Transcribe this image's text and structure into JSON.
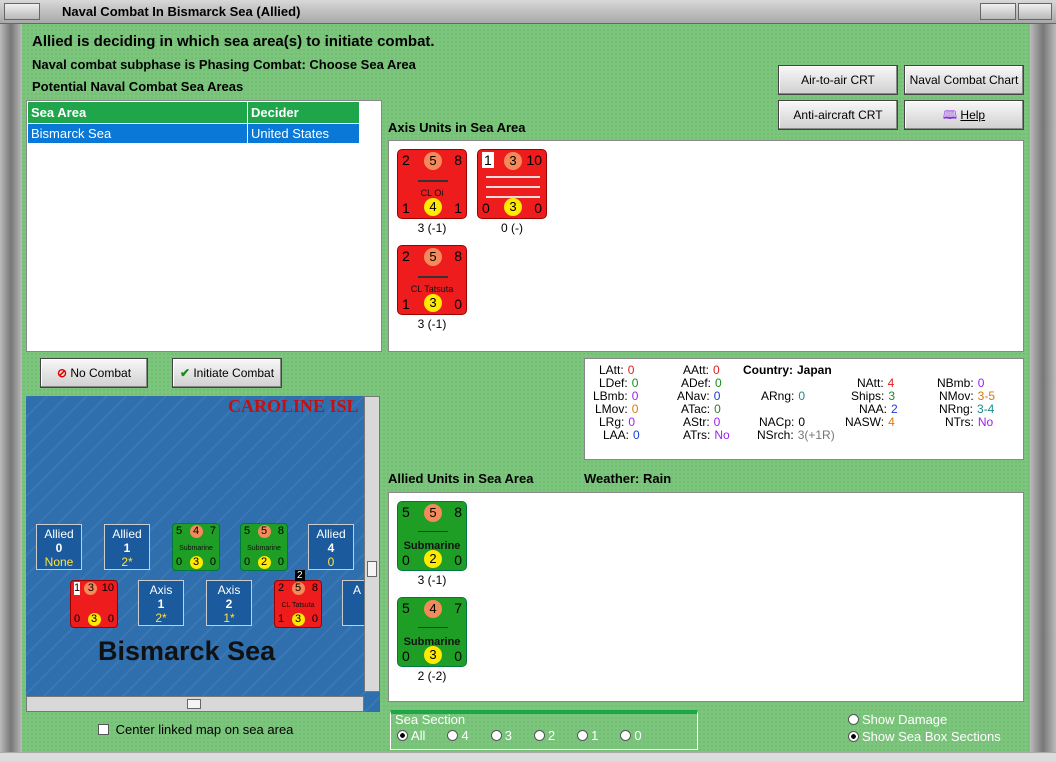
{
  "window": {
    "title": "Naval Combat In Bismarck Sea (Allied)"
  },
  "header": {
    "line1": "Allied is deciding in which sea area(s) to initiate combat.",
    "line2": "Naval combat subphase is Phasing Combat: Choose Sea Area",
    "line3": "Potential Naval Combat Sea Areas"
  },
  "buttons": {
    "air_to_air": "Air-to-air CRT",
    "naval_chart": "Naval Combat Chart",
    "anti_aircraft": "Anti-aircraft CRT",
    "help": "Help",
    "no_combat": "No Combat",
    "initiate_combat": "Initiate Combat"
  },
  "sea_table": {
    "headers": [
      "Sea Area",
      "Decider"
    ],
    "rows": [
      [
        "Bismarck Sea",
        "United States"
      ]
    ]
  },
  "axis_section": {
    "title": "Axis Units in Sea Area"
  },
  "axis_units": [
    {
      "tl": "2",
      "top": "5",
      "tr": "8",
      "name": "CL Oi",
      "bl": "1",
      "bot": "4",
      "br": "1",
      "caption": "3 (-1)"
    },
    {
      "tl": "1",
      "top": "3",
      "tr": "10",
      "name": "",
      "bl": "0",
      "bot": "3",
      "br": "0",
      "caption": "0 (-)"
    },
    {
      "tl": "2",
      "top": "5",
      "tr": "8",
      "name": "CL Tatsuta",
      "bl": "1",
      "bot": "3",
      "br": "0",
      "caption": "3 (-1)"
    }
  ],
  "allied_section": {
    "title": "Allied Units in Sea Area",
    "weather_label": "Weather:",
    "weather": "Rain"
  },
  "allied_units": [
    {
      "tl": "5",
      "top": "5",
      "tr": "8",
      "name": "Submarine",
      "bl": "0",
      "bot": "2",
      "br": "0",
      "caption": "3 (-1)"
    },
    {
      "tl": "5",
      "top": "4",
      "tr": "7",
      "name": "Submarine",
      "bl": "0",
      "bot": "3",
      "br": "0",
      "caption": "2 (-2)"
    }
  ],
  "stats": {
    "country_label": "Country:",
    "country": "Japan",
    "latt": {
      "label": "LAtt:",
      "value": "0"
    },
    "ldef": {
      "label": "LDef:",
      "value": "0"
    },
    "lbmb": {
      "label": "LBmb:",
      "value": "0"
    },
    "lmov": {
      "label": "LMov:",
      "value": "0"
    },
    "lrg": {
      "label": "LRg:",
      "value": "0"
    },
    "laa": {
      "label": "LAA:",
      "value": "0"
    },
    "aatt": {
      "label": "AAtt:",
      "value": "0"
    },
    "adef": {
      "label": "ADef:",
      "value": "0"
    },
    "anav": {
      "label": "ANav:",
      "value": "0"
    },
    "atac": {
      "label": "ATac:",
      "value": "0"
    },
    "astr": {
      "label": "AStr:",
      "value": "0"
    },
    "atrs": {
      "label": "ATrs:",
      "value": "No"
    },
    "arng": {
      "label": "ARng:",
      "value": "0"
    },
    "nacp": {
      "label": "NACp:",
      "value": "0"
    },
    "nsrch": {
      "label": "NSrch:",
      "value": "3(+1R)"
    },
    "natt": {
      "label": "NAtt:",
      "value": "4"
    },
    "ships": {
      "label": "Ships:",
      "value": "3"
    },
    "naa": {
      "label": "NAA:",
      "value": "2"
    },
    "nasw": {
      "label": "NASW:",
      "value": "4"
    },
    "nbmb": {
      "label": "NBmb:",
      "value": "0"
    },
    "nmov": {
      "label": "NMov:",
      "value": "3-5"
    },
    "nrng": {
      "label": "NRng:",
      "value": "3-4"
    },
    "ntrs": {
      "label": "NTrs:",
      "value": "No"
    },
    "colors": {
      "red": "#e21b1b",
      "purple": "#a020f0",
      "blue": "#1a3bd6",
      "teal": "#178a8a",
      "orange": "#d97b00",
      "green": "#1c8b1c",
      "gray": "#777777"
    }
  },
  "map": {
    "region_label": "CAROLINE ISL",
    "sea_label": "Bismarck Sea",
    "boxes": [
      {
        "side": "Allied",
        "num": "0",
        "val": "None"
      },
      {
        "side": "Allied",
        "num": "1",
        "val": "2*"
      },
      {
        "side": "Allied",
        "num": "4",
        "val": "0"
      },
      {
        "side": "Axis",
        "num": "1",
        "val": "2*"
      },
      {
        "side": "Axis",
        "num": "2",
        "val": "1*"
      },
      {
        "side": "A",
        "num": "",
        "val": ""
      }
    ],
    "minis": [
      {
        "tl": "5",
        "top": "4",
        "tr": "7",
        "name": "Submarine",
        "bl": "0",
        "bot": "3",
        "br": "0"
      },
      {
        "tl": "5",
        "top": "5",
        "tr": "8",
        "name": "Submarine",
        "bl": "0",
        "bot": "2",
        "br": "0"
      },
      {
        "tl": "1",
        "top": "3",
        "tr": "10",
        "name": "",
        "bl": "0",
        "bot": "3",
        "br": "0"
      },
      {
        "tl": "2",
        "top": "5",
        "tr": "8",
        "name": "CL Tatsuta",
        "bl": "1",
        "bot": "3",
        "br": "0",
        "badge": "2"
      }
    ]
  },
  "center_map": {
    "label": "Center linked map on sea area"
  },
  "sea_section": {
    "title": "Sea Section",
    "options": [
      "All",
      "4",
      "3",
      "2",
      "1",
      "0"
    ]
  },
  "display_opts": {
    "show_damage": "Show Damage",
    "show_sections": "Show Sea Box Sections"
  }
}
